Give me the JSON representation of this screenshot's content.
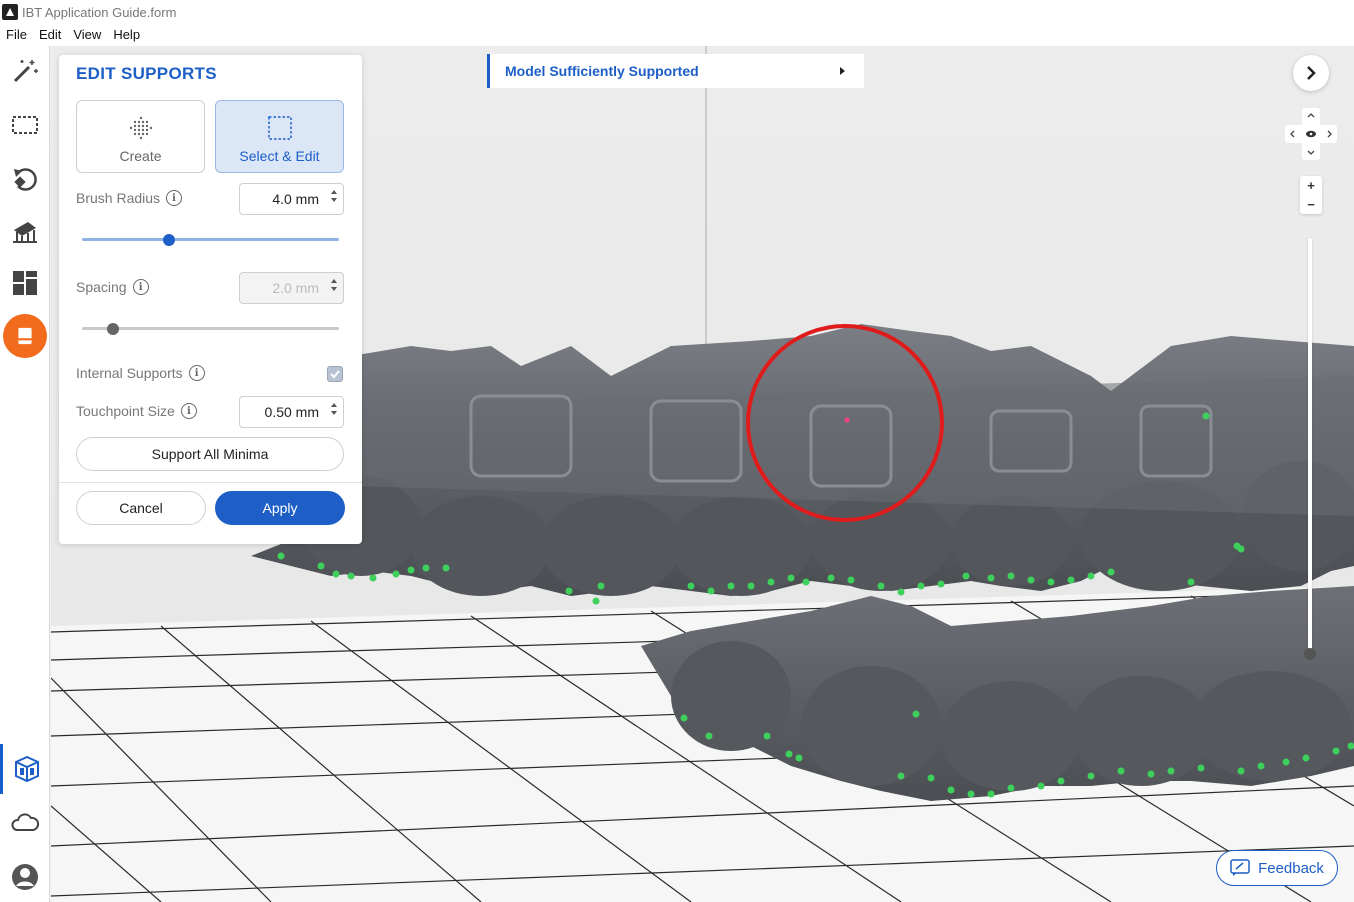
{
  "window": {
    "title": "IBT Application Guide.form"
  },
  "menu": {
    "items": [
      "File",
      "Edit",
      "View",
      "Help"
    ]
  },
  "toolbar": {
    "tools": [
      {
        "name": "magic-wand-icon"
      },
      {
        "name": "select-box-icon"
      },
      {
        "name": "orient-icon"
      },
      {
        "name": "supports-icon"
      },
      {
        "name": "layout-icon"
      },
      {
        "name": "print-icon",
        "active": true
      },
      {
        "name": "model-view-icon"
      },
      {
        "name": "cloud-icon"
      },
      {
        "name": "account-icon"
      }
    ],
    "accent_orange": "#f36b1c",
    "accent_blue": "#1d5fc7"
  },
  "panel": {
    "title": "EDIT SUPPORTS",
    "modes": {
      "create_label": "Create",
      "select_edit_label": "Select & Edit",
      "selected": "select_edit"
    },
    "brush_radius": {
      "label": "Brush Radius",
      "value": "4.0 mm",
      "slider_fraction": 0.34
    },
    "spacing": {
      "label": "Spacing",
      "value": "2.0 mm",
      "disabled": true,
      "slider_fraction": 0.12
    },
    "internal_supports": {
      "label": "Internal Supports",
      "checked": true
    },
    "touchpoint_size": {
      "label": "Touchpoint Size",
      "value": "0.50 mm"
    },
    "support_all_minima_label": "Support All Minima",
    "cancel_label": "Cancel",
    "apply_label": "Apply"
  },
  "status": {
    "text": "Model Sufficiently Supported"
  },
  "view_controls": {
    "zoom_in": "+",
    "zoom_out": "−",
    "zoom_fraction": 1.0
  },
  "feedback": {
    "label": "Feedback"
  },
  "annotation": {
    "circle_color": "#e01b1b"
  }
}
